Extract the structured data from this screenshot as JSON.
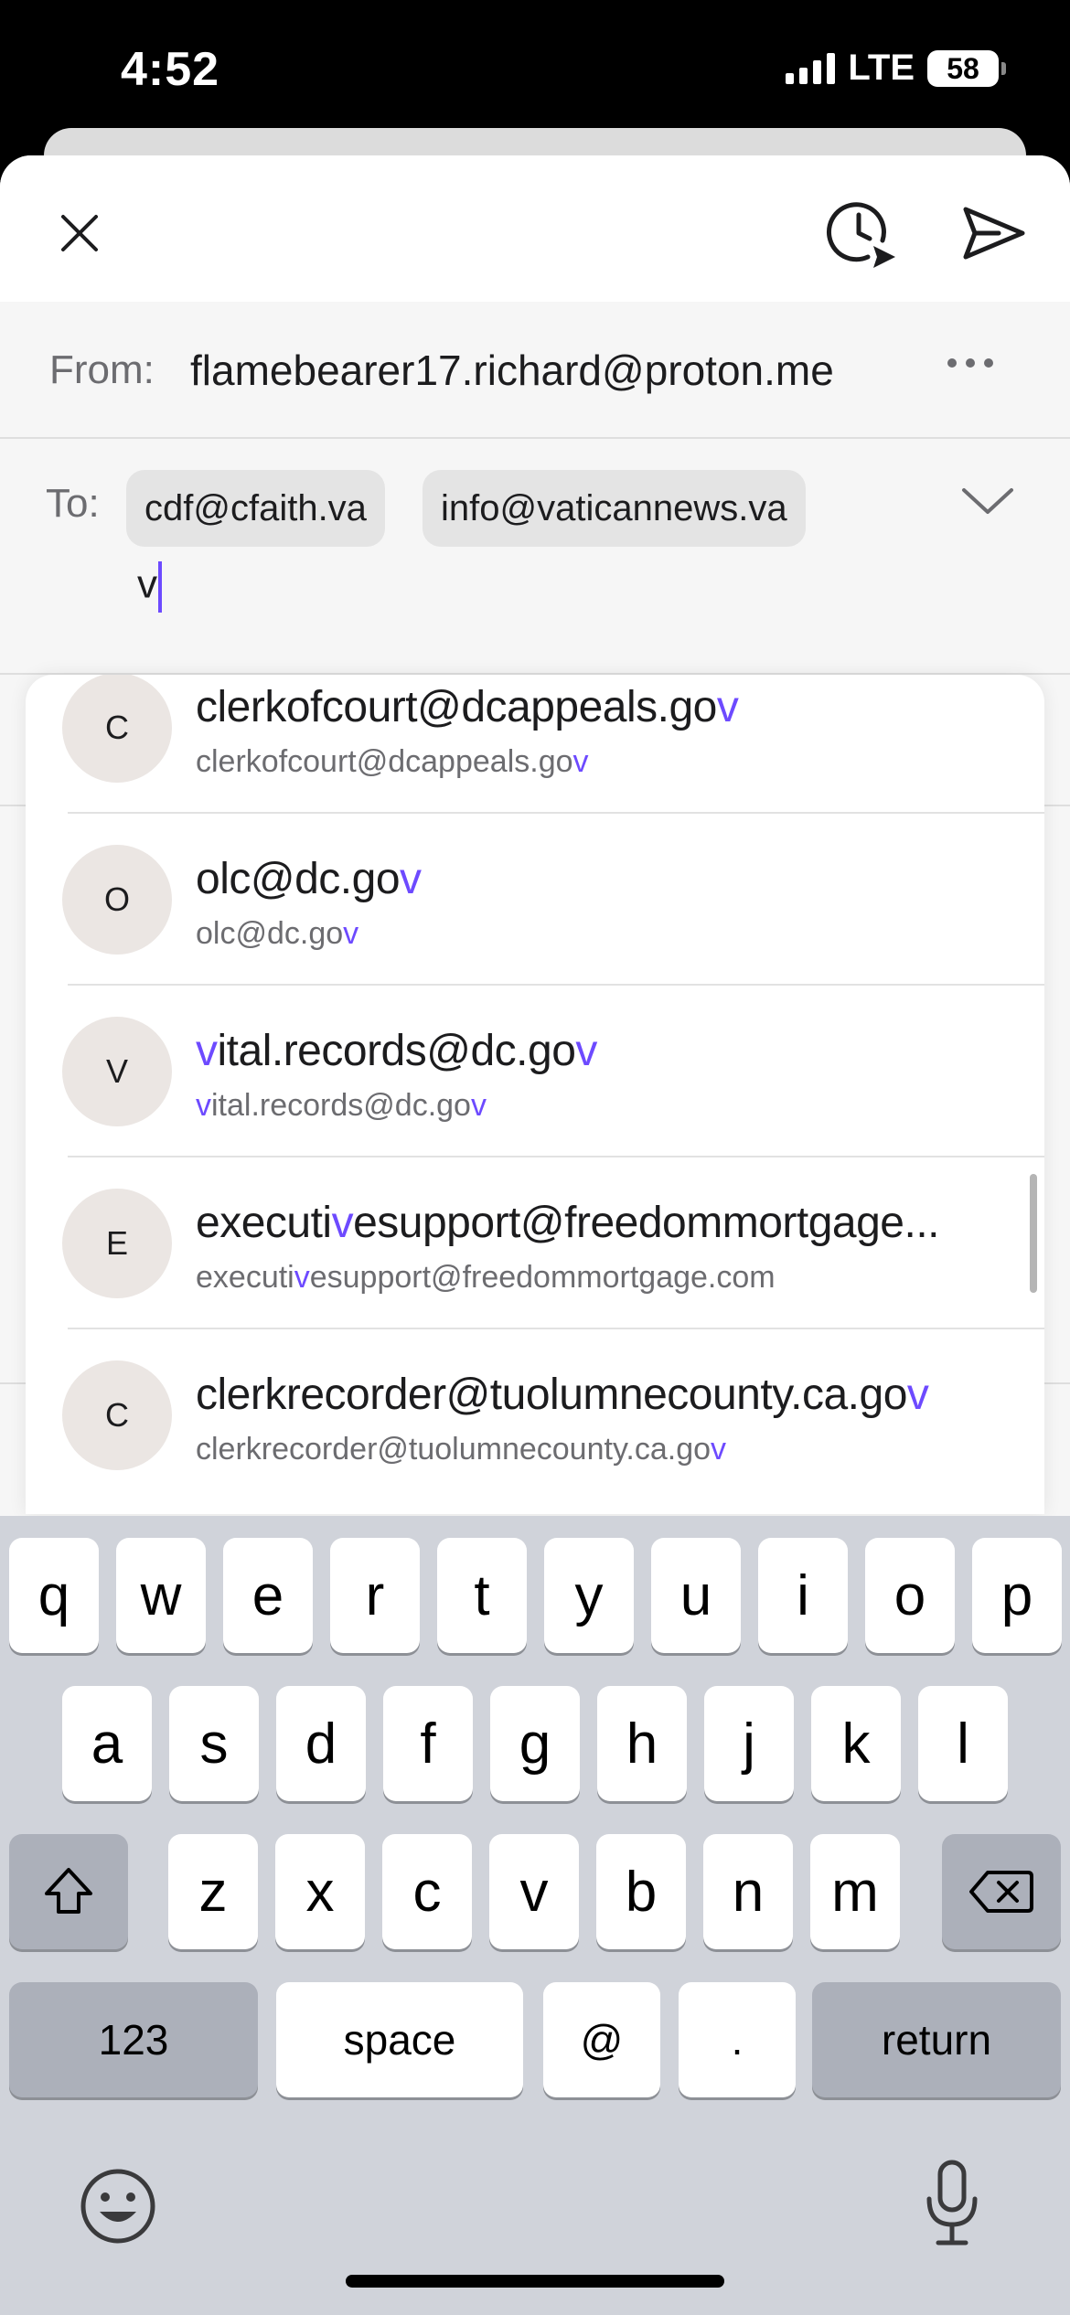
{
  "status_bar": {
    "time": "4:52",
    "network": "LTE",
    "battery": "58"
  },
  "compose": {
    "from_label": "From:",
    "from_value": "flamebearer17.richard@proton.me",
    "to_label": "To:",
    "to_chips": [
      "cdf@cfaith.va",
      "info@vaticannews.va"
    ],
    "to_input_value": "v",
    "icons": {
      "close": "close-icon",
      "schedule": "schedule-send-icon",
      "send": "send-icon",
      "more": "more-options-icon",
      "expand": "chevron-down-icon"
    }
  },
  "suggestions": [
    {
      "initial": "C",
      "name_parts": [
        "clerkofcourt@dcappeals.go",
        "v",
        ""
      ],
      "email_parts": [
        "clerkofcourt@dcappeals.go",
        "v",
        ""
      ]
    },
    {
      "initial": "O",
      "name_parts": [
        "olc@dc.go",
        "v",
        ""
      ],
      "email_parts": [
        "olc@dc.go",
        "v",
        ""
      ]
    },
    {
      "initial": "V",
      "name_parts": [
        "",
        "v",
        "ital.records@dc.go",
        "v",
        ""
      ],
      "email_parts": [
        "",
        "v",
        "ital.records@dc.go",
        "v",
        ""
      ]
    },
    {
      "initial": "E",
      "name_parts": [
        "executi",
        "v",
        "esupport@freedommortgage..."
      ],
      "email_parts": [
        "executi",
        "v",
        "esupport@freedommortgage.com"
      ]
    },
    {
      "initial": "C",
      "name_parts": [
        "clerkrecorder@tuolumnecounty.ca.go",
        "v",
        ""
      ],
      "email_parts": [
        "clerkrecorder@tuolumnecounty.ca.go",
        "v",
        ""
      ]
    }
  ],
  "keyboard": {
    "row1": [
      "q",
      "w",
      "e",
      "r",
      "t",
      "y",
      "u",
      "i",
      "o",
      "p"
    ],
    "row2": [
      "a",
      "s",
      "d",
      "f",
      "g",
      "h",
      "j",
      "k",
      "l"
    ],
    "row3": [
      "z",
      "x",
      "c",
      "v",
      "b",
      "n",
      "m"
    ],
    "numbers_label": "123",
    "space_label": "space",
    "at_label": "@",
    "period_label": ".",
    "return_label": "return",
    "icons": {
      "shift": "shift-icon",
      "delete": "delete-icon",
      "emoji": "emoji-icon",
      "mic": "microphone-icon"
    }
  },
  "colors": {
    "accent": "#6d4aff"
  }
}
